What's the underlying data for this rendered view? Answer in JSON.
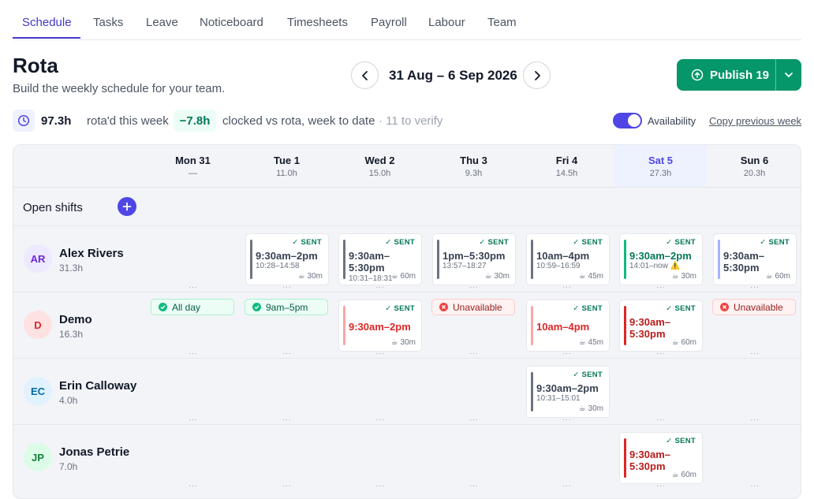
{
  "nav": {
    "tabs": [
      "Schedule",
      "Tasks",
      "Leave",
      "Noticeboard",
      "Timesheets",
      "Payroll",
      "Labour",
      "Team"
    ]
  },
  "page": {
    "title": "Rota",
    "subtitle": "Build the weekly schedule for your team."
  },
  "week": {
    "range": "31 Aug – 6 Sep 2026"
  },
  "publish": {
    "label": "Publish 19"
  },
  "stats": {
    "rota_hours": "97.3h",
    "rota_label": "rota'd this week",
    "variance": "−7.8h",
    "variance_label": "clocked vs rota, week to date",
    "verify": "· 11 to verify",
    "availability_label": "Availability",
    "availability_on": true,
    "copy_previous": "Copy previous week"
  },
  "days": [
    {
      "name": "Mon 31",
      "hours": "—"
    },
    {
      "name": "Tue 1",
      "hours": "11.0h"
    },
    {
      "name": "Wed 2",
      "hours": "15.0h"
    },
    {
      "name": "Thu 3",
      "hours": "9.3h"
    },
    {
      "name": "Fri 4",
      "hours": "14.5h"
    },
    {
      "name": "Sat 5",
      "hours": "27.3h",
      "today": true
    },
    {
      "name": "Sun 6",
      "hours": "20.3h"
    }
  ],
  "open_shifts_label": "Open shifts",
  "more_glyph": "...",
  "sent_label": "SENT",
  "employees": [
    {
      "initials": "AR",
      "name": "Alex Rivers",
      "hours": "31.3h",
      "avatar_bg": "#ede9fe",
      "avatar_fg": "#6d28d9"
    },
    {
      "initials": "D",
      "name": "Demo",
      "hours": "16.3h",
      "avatar_bg": "#fee2e2",
      "avatar_fg": "#dc2626"
    },
    {
      "initials": "EC",
      "name": "Erin Calloway",
      "hours": "4.0h",
      "avatar_bg": "#e0f2fe",
      "avatar_fg": "#0369a1"
    },
    {
      "initials": "JP",
      "name": "Jonas Petrie",
      "hours": "7.0h",
      "avatar_bg": "#dcfce7",
      "avatar_fg": "#15803d"
    }
  ],
  "shifts": {
    "alex_tue": {
      "time": "9:30am–2pm",
      "actual": "10:28–14:58",
      "break": "30m",
      "color": "#6b7280",
      "text_color": "#374151"
    },
    "alex_wed": {
      "time": "9:30am–5:30pm",
      "actual": "10:31–18:31",
      "break": "60m",
      "color": "#6b7280",
      "text_color": "#374151"
    },
    "alex_thu": {
      "time": "1pm–5:30pm",
      "actual": "13:57–18:27",
      "break": "30m",
      "color": "#6b7280",
      "text_color": "#374151"
    },
    "alex_fri": {
      "time": "10am–4pm",
      "actual": "10:59–16:59",
      "break": "45m",
      "color": "#6b7280",
      "text_color": "#374151"
    },
    "alex_sat": {
      "time": "9:30am–2pm",
      "actual": "14:01–now",
      "warning": "⚠️",
      "break": "30m",
      "color": "#10b981",
      "text_color": "#047857"
    },
    "alex_sun": {
      "time": "9:30am–5:30pm",
      "break": "60m",
      "color": "#a5b4fc",
      "text_color": "#374151"
    },
    "demo_wed": {
      "time": "9:30am–2pm",
      "break": "30m",
      "color": "#fca5a5",
      "text_color": "#dc2626"
    },
    "demo_fri": {
      "time": "10am–4pm",
      "break": "45m",
      "color": "#fca5a5",
      "text_color": "#dc2626"
    },
    "demo_sat": {
      "time": "9:30am–5:30pm",
      "break": "60m",
      "color": "#dc2626",
      "text_color": "#b91c1c"
    },
    "erin_fri": {
      "time": "9:30am–2pm",
      "actual": "10:31–15:01",
      "break": "30m",
      "color": "#6b7280",
      "text_color": "#374151"
    },
    "jonas_sat": {
      "time": "9:30am–5:30pm",
      "break": "60m",
      "color": "#dc2626",
      "text_color": "#b91c1c"
    }
  },
  "availability": {
    "demo_mon": "All day",
    "demo_tue": "9am–5pm",
    "demo_thu": "Unavailable",
    "demo_sun": "Unavailable"
  },
  "colors": {
    "accent": "#4f46e5",
    "publish": "#059669",
    "sent": "#047857"
  },
  "icons": [
    "chevron-left-icon",
    "chevron-right-icon",
    "publish-upload-icon",
    "chevron-down-icon",
    "clock-icon",
    "plus-icon",
    "check-icon",
    "break-cup-icon",
    "check-circle-icon",
    "x-circle-icon",
    "warning-icon"
  ]
}
